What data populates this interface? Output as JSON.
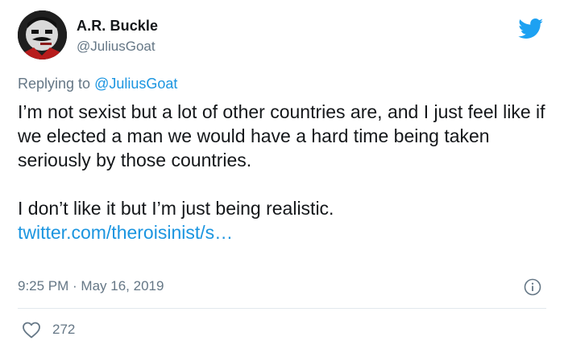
{
  "author": {
    "name": "A.R. Buckle",
    "handle": "@JuliusGoat"
  },
  "reply": {
    "prefix": "Replying to",
    "mention": "@JuliusGoat"
  },
  "tweet": {
    "paragraph1": "I’m not sexist but a lot of other countries are, and I just feel like if we elected a man we would have a hard time being taken seriously by those countries.",
    "paragraph2": "I don’t like it but I’m just being realistic.",
    "link": "twitter.com/theroisinist/s…"
  },
  "meta": {
    "time": "9:25 PM · May 16, 2019"
  },
  "stats": {
    "likes": "272"
  },
  "colors": {
    "brand": "#1da1f2",
    "link": "#1b95e0",
    "secondary_text": "#657786",
    "divider": "#e1e8ed"
  },
  "icons": {
    "logo": "twitter-bird-icon",
    "info": "info-icon",
    "like": "heart-icon"
  }
}
